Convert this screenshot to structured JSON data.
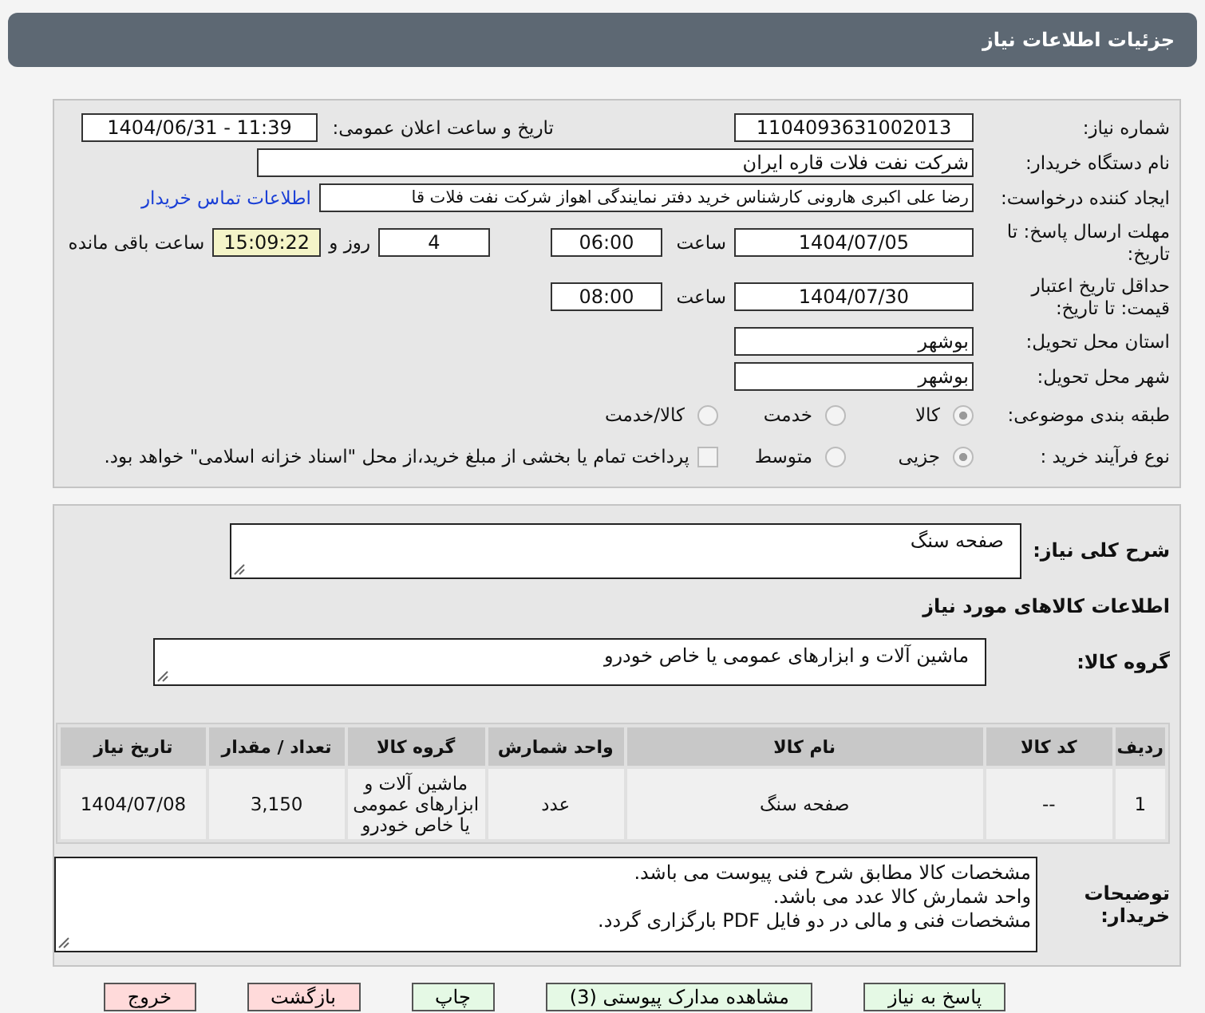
{
  "title": "جزئیات اطلاعات نیاز",
  "need_number": {
    "label": "شماره نیاز:",
    "value": "1104093631002013"
  },
  "announce": {
    "label": "تاریخ و ساعت اعلان عمومی:",
    "value": "1404/06/31 - 11:39"
  },
  "buyer": {
    "label": "نام دستگاه خریدار:",
    "value": "شرکت نفت فلات قاره ایران"
  },
  "requester": {
    "label": "ایجاد کننده درخواست:",
    "value": "رضا علی اکبری هارونی کارشناس خرید دفتر نمایندگی اهواز شرکت نفت فلات قا",
    "link": "اطلاعات تماس خریدار"
  },
  "deadline": {
    "label": "مهلت ارسال پاسخ: تا تاریخ:",
    "date": "1404/07/05",
    "time_label": "ساعت",
    "time": "06:00",
    "days": "4",
    "days_label": "روز و",
    "remaining": "15:09:22",
    "remaining_label": "ساعت باقی مانده"
  },
  "validity": {
    "label": "حداقل تاریخ اعتبار قیمت: تا تاریخ:",
    "date": "1404/07/30",
    "time_label": "ساعت",
    "time": "08:00"
  },
  "province": {
    "label": "استان محل تحویل:",
    "value": "بوشهر"
  },
  "city": {
    "label": "شهر محل تحویل:",
    "value": "بوشهر"
  },
  "category": {
    "label": "طبقه بندی موضوعی:",
    "options": [
      {
        "label": "کالا",
        "selected": true
      },
      {
        "label": "خدمت",
        "selected": false
      },
      {
        "label": "کالا/خدمت",
        "selected": false
      }
    ]
  },
  "process": {
    "label": "نوع فرآیند خرید :",
    "options": [
      {
        "label": "جزیی",
        "selected": true
      },
      {
        "label": "متوسط",
        "selected": false
      }
    ],
    "payment": {
      "checked": false,
      "text": "پرداخت تمام یا بخشی از مبلغ خرید،از محل \"اسناد خزانه اسلامی\" خواهد بود."
    }
  },
  "description": {
    "label": "شرح کلی نیاز:",
    "value": "صفحه سنگ"
  },
  "goods_heading": "اطلاعات کالاهای مورد نیاز",
  "goods_group": {
    "label": "گروه کالا:",
    "value": "ماشین آلات و ابزارهای عمومی یا خاص خودرو"
  },
  "table": {
    "columns": [
      "ردیف",
      "کد کالا",
      "نام کالا",
      "واحد شمارش",
      "گروه کالا",
      "تعداد / مقدار",
      "تاریخ نیاز"
    ],
    "rows": [
      [
        "1",
        "--",
        "صفحه سنگ",
        "عدد",
        "ماشین آلات و ابزارهای عمومی یا خاص خودرو",
        "3,150",
        "1404/07/08"
      ]
    ]
  },
  "notes": {
    "label": "توضیحات خریدار:",
    "lines": [
      "مشخصات کالا مطابق شرح فنی پیوست می باشد.",
      "واحد شمارش کالا عدد می باشد.",
      "مشخصات فنی و مالی در دو فایل PDF  بارگزاری گردد."
    ]
  },
  "buttons": [
    {
      "label": "پاسخ به نیاز",
      "kind": "green"
    },
    {
      "label": "مشاهده مدارک پیوستی (3)",
      "kind": "green"
    },
    {
      "label": "چاپ",
      "kind": "green"
    },
    {
      "label": "بازگشت",
      "kind": "red"
    },
    {
      "label": "خروج",
      "kind": "red"
    }
  ]
}
